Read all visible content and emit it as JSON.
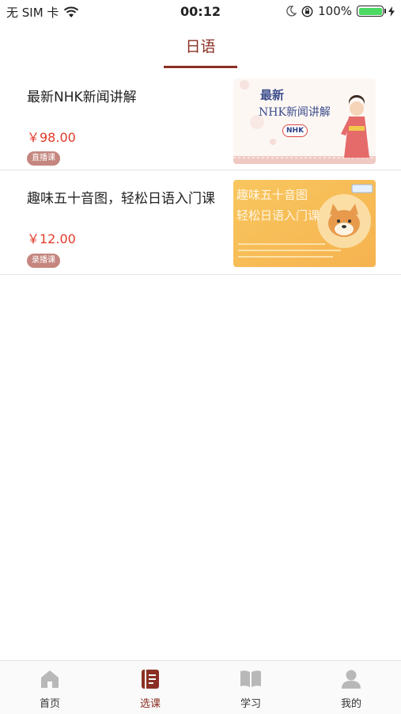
{
  "status_bar": {
    "carrier": "无 SIM 卡",
    "time": "00:12",
    "battery": "100%",
    "battery_level": 1.0,
    "icons": [
      "wifi-icon",
      "moon-icon",
      "orientation-lock-icon",
      "battery-icon",
      "charging-icon"
    ]
  },
  "tabs": [
    {
      "label": "日语",
      "active": true
    }
  ],
  "courses": [
    {
      "title": "最新NHK新闻讲解",
      "price": "￥98.00",
      "badge": "直播课",
      "thumbnail": {
        "line1": "最新",
        "line2": "NHK新闻讲解",
        "logo": "NHK"
      }
    },
    {
      "title": "趣味五十音图，轻松日语入门课",
      "price": "￥12.00",
      "badge": "录播课",
      "thumbnail": {
        "line1": "趣味五十音图",
        "line2": "轻松日语入门课"
      }
    }
  ],
  "bottom_nav": [
    {
      "label": "首页",
      "icon": "home-icon",
      "active": false
    },
    {
      "label": "选课",
      "icon": "book-icon",
      "active": true
    },
    {
      "label": "学习",
      "icon": "open-book-icon",
      "active": false
    },
    {
      "label": "我的",
      "icon": "user-icon",
      "active": false
    }
  ],
  "colors": {
    "accent": "#8b2f24",
    "price": "#e23b2a",
    "badge": "#c4867f",
    "inactive_icon": "#b8b8b8"
  }
}
